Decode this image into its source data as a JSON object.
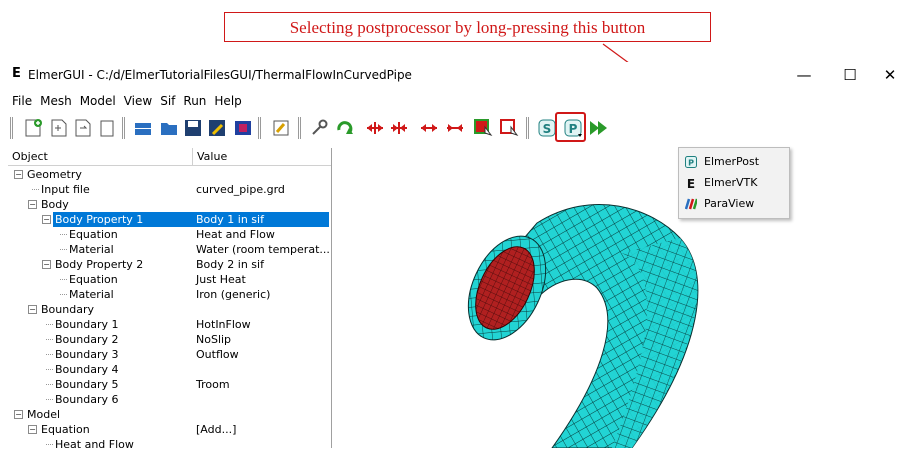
{
  "annotation": {
    "text": "Selecting postprocessor by long-pressing this button"
  },
  "window": {
    "logo": "E",
    "title": "ElmerGUI - C:/d/ElmerTutorialFilesGUI/ThermalFlowInCurvedPipe",
    "minimize_glyph": "—",
    "maximize_glyph": "☐",
    "close_glyph": "✕"
  },
  "menu": {
    "items": [
      "File",
      "Mesh",
      "Model",
      "View",
      "Sif",
      "Run",
      "Help"
    ]
  },
  "tree": {
    "col_object": "Object",
    "col_value": "Value",
    "rows": [
      {
        "label": "Geometry",
        "value": ""
      },
      {
        "label": "Input file",
        "value": "curved_pipe.grd"
      },
      {
        "label": "Body",
        "value": ""
      },
      {
        "label": "Body Property 1",
        "value": "Body 1 in sif"
      },
      {
        "label": "Equation",
        "value": "Heat and Flow"
      },
      {
        "label": "Material",
        "value": "Water (room temperat..."
      },
      {
        "label": "Body Property 2",
        "value": "Body 2 in sif"
      },
      {
        "label": "Equation",
        "value": "Just Heat"
      },
      {
        "label": "Material",
        "value": "Iron (generic)"
      },
      {
        "label": "Boundary",
        "value": ""
      },
      {
        "label": "Boundary 1",
        "value": "HotInFlow"
      },
      {
        "label": "Boundary 2",
        "value": "NoSlip"
      },
      {
        "label": "Boundary 3",
        "value": "Outflow"
      },
      {
        "label": "Boundary 4",
        "value": ""
      },
      {
        "label": "Boundary 5",
        "value": "Troom"
      },
      {
        "label": "Boundary 6",
        "value": ""
      },
      {
        "label": "Model",
        "value": ""
      },
      {
        "label": "Equation",
        "value": "[Add...]"
      },
      {
        "label": "Heat and Flow",
        "value": ""
      }
    ]
  },
  "postprocessor_menu": {
    "items": [
      {
        "label": "ElmerPost",
        "icon": "elmerpost-icon"
      },
      {
        "label": "ElmerVTK",
        "icon": "elmervtk-icon"
      },
      {
        "label": "ParaView",
        "icon": "paraview-icon"
      }
    ]
  },
  "colors": {
    "annotation": "#d01818",
    "selection": "#0078d7",
    "mesh": "#22d4d4",
    "mesh_end": "#b02020"
  }
}
